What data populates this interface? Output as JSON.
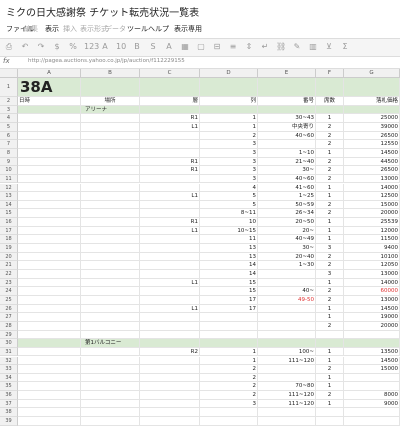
{
  "window": {
    "title": "ミクの日大感謝祭 チケット転売状況一覧表"
  },
  "menu": [
    {
      "label": "ファイル",
      "dim": false
    },
    {
      "label": "編集",
      "dim": true
    },
    {
      "label": "表示",
      "dim": false
    },
    {
      "label": "挿入",
      "dim": true
    },
    {
      "label": "表示形式",
      "dim": true
    },
    {
      "label": "データ",
      "dim": true
    },
    {
      "label": "ツール",
      "dim": false
    },
    {
      "label": "ヘルプ",
      "dim": false
    },
    {
      "label": "表示専用",
      "dim": false
    }
  ],
  "toolbar": {
    "icons": [
      "print-icon",
      "undo-icon",
      "redo-icon",
      "currency-icon",
      "percent-icon",
      "number-format-icon",
      "font-icon",
      "size-icon",
      "bold-icon",
      "strikethrough-icon",
      "text-color-icon",
      "fill-color-icon",
      "borders-icon",
      "merge-icon",
      "align-icon",
      "valign-icon",
      "wrap-icon",
      "insert-link-icon",
      "comment-icon",
      "chart-icon",
      "filter-icon",
      "functions-icon"
    ]
  },
  "formula_bar": {
    "fx": "fx",
    "value": "http://pagea.auctions.yahoo.co.jp/jp/auction/f112229155"
  },
  "columns": [
    "A",
    "B",
    "C",
    "D",
    "E",
    "F",
    "G"
  ],
  "rows": [
    {
      "n": "1",
      "cells": [
        "38A",
        "",
        "",
        "",
        "",
        "",
        ""
      ],
      "style": "title"
    },
    {
      "n": "2",
      "cells": [
        "日時",
        "場所",
        "層",
        "列",
        "番号",
        "席数",
        "落札価格"
      ],
      "style": "header"
    },
    {
      "n": "3",
      "cells": [
        "",
        "アリーナ",
        "",
        "",
        "",
        "",
        ""
      ],
      "style": "section"
    },
    {
      "n": "4",
      "cells": [
        "",
        "",
        "R1",
        "1",
        "30~43",
        "1",
        "25000"
      ]
    },
    {
      "n": "5",
      "cells": [
        "",
        "",
        "L1",
        "1",
        "中央寄り",
        "2",
        "39000"
      ]
    },
    {
      "n": "6",
      "cells": [
        "",
        "",
        "",
        "2",
        "40~60",
        "2",
        "26500"
      ]
    },
    {
      "n": "7",
      "cells": [
        "",
        "",
        "",
        "3",
        "",
        "2",
        "12550"
      ]
    },
    {
      "n": "8",
      "cells": [
        "",
        "",
        "",
        "3",
        "1~10",
        "1",
        "14500"
      ]
    },
    {
      "n": "9",
      "cells": [
        "",
        "",
        "R1",
        "3",
        "21~40",
        "2",
        "44500"
      ]
    },
    {
      "n": "10",
      "cells": [
        "",
        "",
        "R1",
        "3",
        "30~",
        "2",
        "26500"
      ]
    },
    {
      "n": "11",
      "cells": [
        "",
        "",
        "",
        "3",
        "40~60",
        "2",
        "13000"
      ]
    },
    {
      "n": "12",
      "cells": [
        "",
        "",
        "",
        "4",
        "41~60",
        "1",
        "14000"
      ]
    },
    {
      "n": "13",
      "cells": [
        "",
        "",
        "L1",
        "5",
        "1~25",
        "1",
        "12500"
      ]
    },
    {
      "n": "14",
      "cells": [
        "",
        "",
        "",
        "5",
        "50~59",
        "2",
        "15000"
      ]
    },
    {
      "n": "15",
      "cells": [
        "",
        "",
        "",
        "8~11",
        "26~34",
        "2",
        "20000"
      ]
    },
    {
      "n": "16",
      "cells": [
        "",
        "",
        "R1",
        "10",
        "20~50",
        "1",
        "25539"
      ]
    },
    {
      "n": "17",
      "cells": [
        "",
        "",
        "L1",
        "10~15",
        "20~",
        "1",
        "12000"
      ]
    },
    {
      "n": "18",
      "cells": [
        "",
        "",
        "",
        "11",
        "40~49",
        "1",
        "11500"
      ]
    },
    {
      "n": "19",
      "cells": [
        "",
        "",
        "",
        "13",
        "30~",
        "3",
        "9400"
      ]
    },
    {
      "n": "20",
      "cells": [
        "",
        "",
        "",
        "13",
        "20~40",
        "2",
        "10100"
      ]
    },
    {
      "n": "21",
      "cells": [
        "",
        "",
        "",
        "14",
        "1~30",
        "2",
        "12050"
      ]
    },
    {
      "n": "22",
      "cells": [
        "",
        "",
        "",
        "14",
        "",
        "3",
        "13000"
      ]
    },
    {
      "n": "23",
      "cells": [
        "",
        "",
        "L1",
        "15",
        "",
        "1",
        "14000"
      ]
    },
    {
      "n": "24",
      "cells": [
        "",
        "",
        "",
        "15",
        "40~",
        "2",
        "60000"
      ],
      "red": [
        6
      ]
    },
    {
      "n": "25",
      "cells": [
        "",
        "",
        "",
        "17",
        "49-50",
        "2",
        "13000"
      ],
      "red": [
        4
      ]
    },
    {
      "n": "26",
      "cells": [
        "",
        "",
        "L1",
        "17",
        "",
        "1",
        "14500"
      ]
    },
    {
      "n": "27",
      "cells": [
        "",
        "",
        "",
        "",
        "",
        "1",
        "19000"
      ]
    },
    {
      "n": "28",
      "cells": [
        "",
        "",
        "",
        "",
        "",
        "2",
        "20000"
      ]
    },
    {
      "n": "29",
      "cells": [
        "",
        "",
        "",
        "",
        "",
        "",
        ""
      ]
    },
    {
      "n": "30",
      "cells": [
        "",
        "第1バルコニー",
        "",
        "",
        "",
        "",
        ""
      ],
      "style": "section"
    },
    {
      "n": "31",
      "cells": [
        "",
        "",
        "R2",
        "1",
        "100~",
        "1",
        "13500"
      ]
    },
    {
      "n": "32",
      "cells": [
        "",
        "",
        "",
        "1",
        "111~120",
        "1",
        "14500"
      ]
    },
    {
      "n": "33",
      "cells": [
        "",
        "",
        "",
        "2",
        "",
        "2",
        "15000"
      ]
    },
    {
      "n": "34",
      "cells": [
        "",
        "",
        "",
        "2",
        "",
        "1",
        ""
      ]
    },
    {
      "n": "35",
      "cells": [
        "",
        "",
        "",
        "2",
        "70~80",
        "1",
        ""
      ]
    },
    {
      "n": "36",
      "cells": [
        "",
        "",
        "",
        "2",
        "111~120",
        "2",
        "8000"
      ]
    },
    {
      "n": "37",
      "cells": [
        "",
        "",
        "",
        "3",
        "111~120",
        "1",
        "9000"
      ]
    },
    {
      "n": "38",
      "cells": [
        "",
        "",
        "",
        "",
        "",
        "",
        ""
      ]
    },
    {
      "n": "39",
      "cells": [
        "",
        "",
        "",
        "",
        "",
        "",
        ""
      ]
    }
  ],
  "colors": {
    "section_fill": "#d9ead3",
    "negative_red": "#e03030"
  }
}
